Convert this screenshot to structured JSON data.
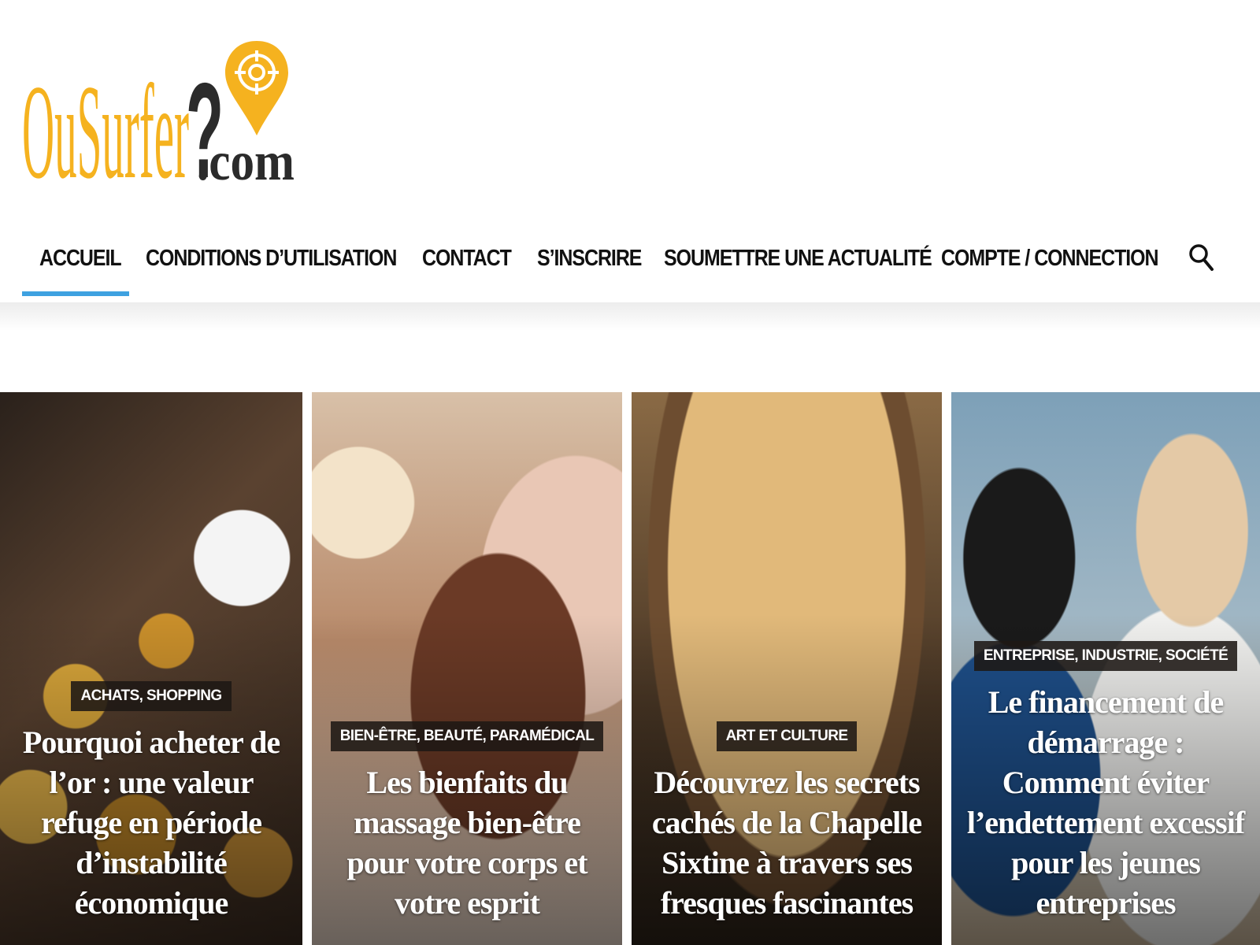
{
  "header": {
    "logo": {
      "brand": "OuSurfer",
      "question_mark": "?",
      "suffix": ".com",
      "icon": "location-target-pin"
    }
  },
  "nav": {
    "items": [
      {
        "label": "ACCUEIL",
        "active": true
      },
      {
        "label": "CONDITIONS D’UTILISATION",
        "active": false
      },
      {
        "label": "CONTACT",
        "active": false
      },
      {
        "label": "S’INSCRIRE",
        "active": false
      },
      {
        "label": "SOUMETTRE UNE ACTUALITÉ",
        "active": false
      },
      {
        "label": "COMPTE / CONNECTION",
        "active": false
      }
    ],
    "search_icon": "search-icon",
    "active_color": "#3ea1e0"
  },
  "posts": [
    {
      "category": "ACHATS, SHOPPING",
      "title": "Pourquoi acheter de l’or : une valeur refuge en période d’instabilité économique"
    },
    {
      "category": "BIEN-ÊTRE, BEAUTÉ, PARAMÉDICAL",
      "title": "Les bienfaits du massage bien-être pour votre corps et votre esprit"
    },
    {
      "category": "ART ET CULTURE",
      "title": "Découvrez les secrets cachés de la Chapelle Sixtine à travers ses fresques fascinantes"
    },
    {
      "category": "ENTREPRISE, INDUSTRIE, SOCIÉTÉ",
      "title": "Le financement de démarrage : Comment éviter l’endettement excessif pour les jeunes entreprises"
    }
  ],
  "colors": {
    "logo_yellow": "#f5b21f",
    "logo_dark": "#2b2b2b",
    "badge_bg": "#1e1814"
  }
}
